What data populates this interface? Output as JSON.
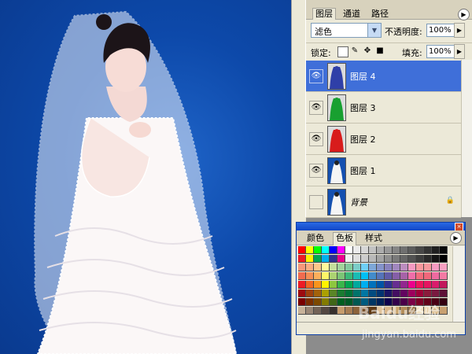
{
  "layers_panel": {
    "tabs": [
      "图层",
      "通道",
      "路径"
    ],
    "blend_mode": "滤色",
    "opacity_label": "不透明度:",
    "opacity_value": "100%",
    "lock_label": "锁定:",
    "fill_label": "填充:",
    "fill_value": "100%",
    "layers": [
      {
        "name": "图层 4",
        "visible": true,
        "selected": true,
        "thumb_color": "#2f3fa8"
      },
      {
        "name": "图层 3",
        "visible": true,
        "selected": false,
        "thumb_color": "#18a030"
      },
      {
        "name": "图层 2",
        "visible": true,
        "selected": false,
        "thumb_color": "#d81c1c"
      },
      {
        "name": "图层 1",
        "visible": true,
        "selected": false,
        "thumb_color": "#1450b0"
      },
      {
        "name": "背景",
        "visible": false,
        "selected": false,
        "locked": true,
        "thumb_color": "#1450b0"
      }
    ]
  },
  "swatches_panel": {
    "tabs": [
      "颜色",
      "色板",
      "样式"
    ],
    "active_tab": "色板"
  },
  "watermark": {
    "line1": "Baidu经验",
    "line2": "jingyan.baidu.com"
  },
  "icons": {
    "visibility": "eye-icon",
    "panel_menu": "panel-menu-icon",
    "lock": "lock-icon",
    "move": "move-icon",
    "brush": "brush-icon",
    "transparency": "transparency-lock-icon"
  }
}
